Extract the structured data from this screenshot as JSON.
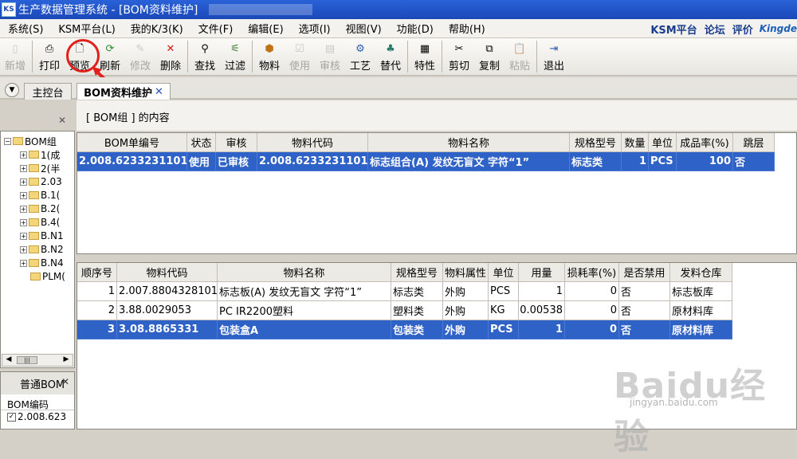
{
  "title": {
    "app_icon": "KS",
    "text": "生产数据管理系统 - [BOM资料维护]"
  },
  "menu": {
    "items": [
      "系统(S)",
      "KSM平台(L)",
      "我的K/3(K)",
      "文件(F)",
      "编辑(E)",
      "选项(I)",
      "视图(V)",
      "功能(D)",
      "帮助(H)"
    ],
    "right_links": [
      "KSM平台",
      "论坛",
      "评价"
    ],
    "brand": "Kingde"
  },
  "toolbar": {
    "new": "新增",
    "print": "打印",
    "preview": "预览",
    "refresh": "刷新",
    "modify": "修改",
    "delete": "删除",
    "find": "查找",
    "filter": "过滤",
    "material": "物料",
    "use": "使用",
    "audit": "审核",
    "process": "工艺",
    "substitute": "替代",
    "property": "特性",
    "cut": "剪切",
    "copy": "复制",
    "paste": "粘贴",
    "exit": "退出"
  },
  "tabs": {
    "console": "主控台",
    "bom": "BOM资料维护"
  },
  "content_header": "[ BOM组 ] 的内容",
  "tree": {
    "root": "BOM组",
    "nodes": [
      "1(成",
      "2(半",
      "2.03",
      "B.1(",
      "B.2(",
      "B.4(",
      "B.N1",
      "B.N2",
      "B.N4",
      "PLM("
    ]
  },
  "left_bottom": {
    "title": "普通BOM",
    "col": "BOM编码",
    "row": "2.008.623"
  },
  "bom_table": {
    "headers": [
      "BOM单编号",
      "状态",
      "审核",
      "物料代码",
      "物料名称",
      "规格型号",
      "数量",
      "单位",
      "成品率(%)",
      "跳层"
    ],
    "rows": [
      [
        "2.008.6233231101",
        "使用",
        "已审核",
        "2.008.6233231101",
        "标志组合(A) 发纹无盲文 字符“1”",
        "标志类",
        "1",
        "PCS",
        "100",
        "否"
      ]
    ]
  },
  "detail_table": {
    "headers": [
      "顺序号",
      "物料代码",
      "物料名称",
      "规格型号",
      "物料属性",
      "单位",
      "用量",
      "损耗率(%)",
      "是否禁用",
      "发料仓库"
    ],
    "rows": [
      [
        "1",
        "2.007.8804328101",
        "标志板(A) 发纹无盲文 字符“1”",
        "标志类",
        "外购",
        "PCS",
        "1",
        "0",
        "否",
        "标志板库"
      ],
      [
        "2",
        "3.88.0029053",
        "PC IR2200塑料",
        "塑料类",
        "外购",
        "KG",
        "0.00538",
        "0",
        "否",
        "原材料库"
      ],
      [
        "3",
        "3.08.8865331",
        "包装盒A",
        "包装类",
        "外购",
        "PCS",
        "1",
        "0",
        "否",
        "原材料库"
      ]
    ]
  },
  "watermark": {
    "text": "Baidu经验",
    "sub": "jingyan.baidu.com"
  },
  "colors": {
    "selection": "#2f62c6",
    "title": "#1a48b8",
    "annotation": "#e0201a"
  }
}
